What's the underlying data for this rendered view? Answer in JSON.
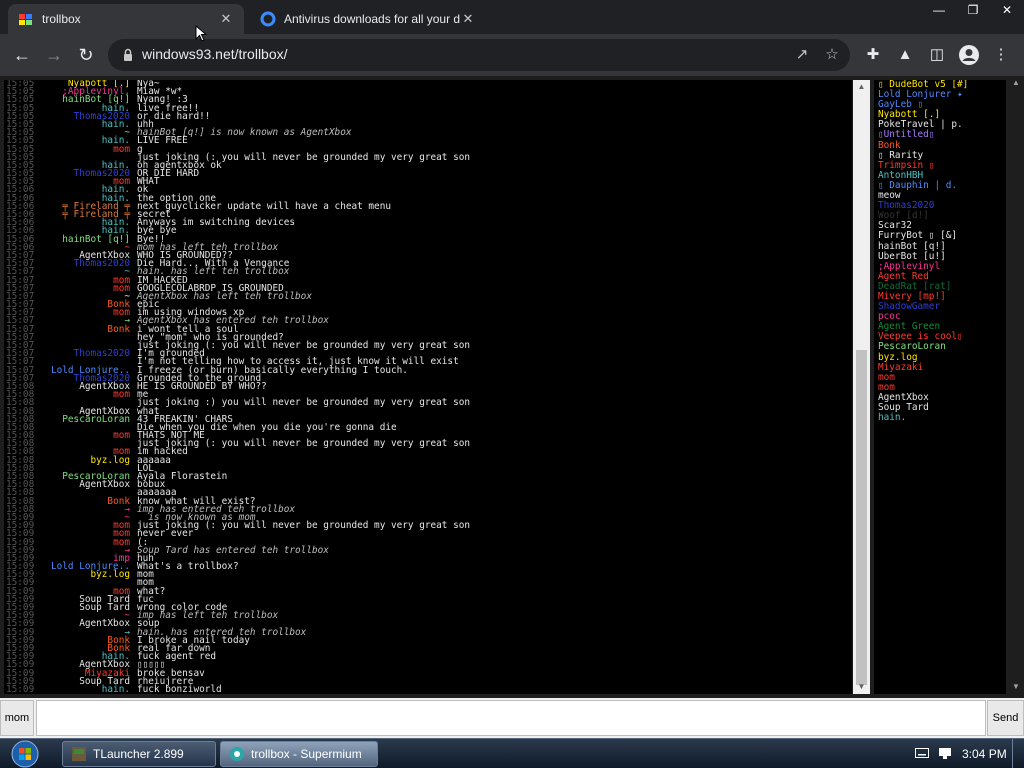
{
  "browser": {
    "tabs": [
      {
        "title": "trollbox",
        "close": "✕"
      },
      {
        "title": "Antivirus downloads for all your de",
        "close": "✕"
      }
    ],
    "window_buttons": [
      "—",
      "❐",
      "✕"
    ],
    "url": "windows93.net/trollbox/"
  },
  "chat": {
    "messages": [
      {
        "time": "15:05",
        "nick": "Nyabott [.]",
        "nick_color": "#ffe600",
        "text": "Nya~",
        "sys": false
      },
      {
        "time": "15:05",
        "nick": ";Applevinyl.",
        "nick_color": "#ff3399",
        "text": "Miaw *w*",
        "sys": false
      },
      {
        "time": "15:05",
        "nick": "hainBot [q!]",
        "nick_color": "#7ee07e",
        "text": "Nyang! :3",
        "sys": false
      },
      {
        "time": "15:05",
        "nick": "hain.",
        "nick_color": "#4fc3c3",
        "text": "live free!!",
        "sys": false
      },
      {
        "time": "15:05",
        "nick": "Thomas2020",
        "nick_color": "#2f3fd0",
        "text": "or die hard!!",
        "sys": false
      },
      {
        "time": "15:05",
        "nick": "hain.",
        "nick_color": "#4fc3c3",
        "text": "uhh",
        "sys": false
      },
      {
        "time": "15:05",
        "nick": "~",
        "nick_color": "#7ee07e",
        "text": "hainBot [q!] is now known as AgentXbox",
        "sys": true
      },
      {
        "time": "15:05",
        "nick": "hain.",
        "nick_color": "#4fc3c3",
        "text": "LIVE FREE",
        "sys": false
      },
      {
        "time": "15:05",
        "nick": "mom",
        "nick_color": "#ff3b30",
        "text": "g",
        "sys": false
      },
      {
        "time": "15:05",
        "nick": "",
        "nick_color": "#ff3b30",
        "text": "just joking (: you will never be grounded my very great son",
        "sys": false
      },
      {
        "time": "15:05",
        "nick": "hain.",
        "nick_color": "#4fc3c3",
        "text": "oh agentxbox ok",
        "sys": false
      },
      {
        "time": "15:05",
        "nick": "Thomas2020",
        "nick_color": "#2f3fd0",
        "text": "OR DIE HARD",
        "sys": false
      },
      {
        "time": "15:05",
        "nick": "mom",
        "nick_color": "#ff3b30",
        "text": "WHAT",
        "sys": false
      },
      {
        "time": "15:06",
        "nick": "hain.",
        "nick_color": "#4fc3c3",
        "text": "ok",
        "sys": false
      },
      {
        "time": "15:06",
        "nick": "hain.",
        "nick_color": "#4fc3c3",
        "text": "the option one",
        "sys": false
      },
      {
        "time": "15:06",
        "nick": "╤ Fireland ╤",
        "nick_color": "#e07a3a",
        "text": "next guyclicker update will have a cheat menu",
        "sys": false
      },
      {
        "time": "15:06",
        "nick": "╤ Fireland ╤",
        "nick_color": "#e07a3a",
        "text": "secret",
        "sys": false
      },
      {
        "time": "15:06",
        "nick": "hain.",
        "nick_color": "#4fc3c3",
        "text": "Anyways im switching devices",
        "sys": false
      },
      {
        "time": "15:06",
        "nick": "hain.",
        "nick_color": "#4fc3c3",
        "text": "bye bye",
        "sys": false
      },
      {
        "time": "15:06",
        "nick": "hainBot [q!]",
        "nick_color": "#7ee07e",
        "text": "Bye!!",
        "sys": false
      },
      {
        "time": "15:06",
        "nick": "~",
        "nick_color": "#ff3b30",
        "text": "mom has left teh trollbox",
        "sys": true
      },
      {
        "time": "15:07",
        "nick": "AgentXbox",
        "nick_color": "#e6e6e6",
        "text": "WHO IS GROUNDED??",
        "sys": false
      },
      {
        "time": "15:07",
        "nick": "Thomas2020",
        "nick_color": "#2f3fd0",
        "text": "Die Hard... With a Vengance",
        "sys": false
      },
      {
        "time": "15:07",
        "nick": "~",
        "nick_color": "#4fc3c3",
        "text": "hain. has left teh trollbox",
        "sys": true
      },
      {
        "time": "15:07",
        "nick": "mom",
        "nick_color": "#ff3b30",
        "text": "IM HACKED",
        "sys": false
      },
      {
        "time": "15:07",
        "nick": "mom",
        "nick_color": "#ff3b30",
        "text": "GOOGLECOLABRDP IS GROUNDED",
        "sys": false
      },
      {
        "time": "15:07",
        "nick": "~",
        "nick_color": "#e6e6e6",
        "text": "AgentXbox has left teh trollbox",
        "sys": true
      },
      {
        "time": "15:07",
        "nick": "Bonk",
        "nick_color": "#ff5a1f",
        "text": "epic",
        "sys": false
      },
      {
        "time": "15:07",
        "nick": "mom",
        "nick_color": "#ff3b30",
        "text": "im using windows xp",
        "sys": false
      },
      {
        "time": "15:07",
        "nick": "→",
        "nick_color": "#7ee07e",
        "text": "AgentXbox has entered teh trollbox",
        "sys": true
      },
      {
        "time": "15:07",
        "nick": "Bonk",
        "nick_color": "#ff5a1f",
        "text": "i wont tell a soul",
        "sys": false
      },
      {
        "time": "15:07",
        "nick": "",
        "nick_color": "#ff5a1f",
        "text": "hey \"mom\" who is grounded?",
        "sys": false
      },
      {
        "time": "15:07",
        "nick": "",
        "nick_color": "#ff3b30",
        "text": "just joking (: you will never be grounded my very great son",
        "sys": false
      },
      {
        "time": "15:07",
        "nick": "Thomas2020",
        "nick_color": "#2f3fd0",
        "text": "I'm grounded",
        "sys": false
      },
      {
        "time": "15:07",
        "nick": "",
        "nick_color": "#2f3fd0",
        "text": "I'm not telling how to access it, just know it will exist",
        "sys": false
      },
      {
        "time": "15:07",
        "nick": "Lold Lonjure..",
        "nick_color": "#4f8cff",
        "text": "I freeze (or burn) basically everything I touch.",
        "sys": false
      },
      {
        "time": "15:07",
        "nick": "Thomas2020",
        "nick_color": "#2f3fd0",
        "text": "Grounded to the ground",
        "sys": false
      },
      {
        "time": "15:08",
        "nick": "AgentXbox",
        "nick_color": "#e6e6e6",
        "text": "HE IS GROUNDED BY WHO??",
        "sys": false
      },
      {
        "time": "15:08",
        "nick": "mom",
        "nick_color": "#ff3b30",
        "text": "me",
        "sys": false
      },
      {
        "time": "15:08",
        "nick": "",
        "nick_color": "#ff3b30",
        "text": "just joking :) you will never be grounded my very great son",
        "sys": false
      },
      {
        "time": "15:08",
        "nick": "AgentXbox",
        "nick_color": "#e6e6e6",
        "text": "what",
        "sys": false
      },
      {
        "time": "15:08",
        "nick": "PescaroLoran",
        "nick_color": "#7ee07e",
        "text": "43 FREAKIN' CHARS",
        "sys": false
      },
      {
        "time": "15:08",
        "nick": "",
        "nick_color": "#7ee07e",
        "text": "Die when you die when you die you're gonna die",
        "sys": false
      },
      {
        "time": "15:08",
        "nick": "mom",
        "nick_color": "#ff3b30",
        "text": "THATS NOT ME",
        "sys": false
      },
      {
        "time": "15:08",
        "nick": "",
        "nick_color": "#ff3b30",
        "text": "just joking (: you will never be grounded my very great son",
        "sys": false
      },
      {
        "time": "15:08",
        "nick": "mom",
        "nick_color": "#ff3b30",
        "text": "im hacked",
        "sys": false
      },
      {
        "time": "15:08",
        "nick": "byz.log",
        "nick_color": "#ffe600",
        "text": "aaaaaa",
        "sys": false
      },
      {
        "time": "15:08",
        "nick": "",
        "nick_color": "#ffe600",
        "text": "LOL",
        "sys": false
      },
      {
        "time": "15:08",
        "nick": "PescaroLoran",
        "nick_color": "#7ee07e",
        "text": "Ayala Florastein",
        "sys": false
      },
      {
        "time": "15:08",
        "nick": "AgentXbox",
        "nick_color": "#e6e6e6",
        "text": "bobux",
        "sys": false
      },
      {
        "time": "15:08",
        "nick": "",
        "nick_color": "#e6e6e6",
        "text": "aaaaaaa",
        "sys": false
      },
      {
        "time": "15:08",
        "nick": "Bonk",
        "nick_color": "#ff5a1f",
        "text": "know what will exist?",
        "sys": false
      },
      {
        "time": "15:08",
        "nick": "→",
        "nick_color": "#ff3399",
        "text": "imp has entered teh trollbox",
        "sys": true
      },
      {
        "time": "15:09",
        "nick": "~",
        "nick_color": "#ff3399",
        "text": "  is now known as mom",
        "sys": true
      },
      {
        "time": "15:09",
        "nick": "mom",
        "nick_color": "#ff3b30",
        "text": "just joking (: you will never be grounded my very great son",
        "sys": false
      },
      {
        "time": "15:09",
        "nick": "mom",
        "nick_color": "#ff3b30",
        "text": "never ever",
        "sys": false
      },
      {
        "time": "15:09",
        "nick": "mom",
        "nick_color": "#ff3b30",
        "text": "(:",
        "sys": false
      },
      {
        "time": "15:09",
        "nick": "→",
        "nick_color": "#ff3399",
        "text": "Soup Tard has entered teh trollbox",
        "sys": true
      },
      {
        "time": "15:09",
        "nick": "imp",
        "nick_color": "#ff3399",
        "text": "huh",
        "sys": false
      },
      {
        "time": "15:09",
        "nick": "Lold Lonjure..",
        "nick_color": "#4f8cff",
        "text": "What's a trollbox?",
        "sys": false
      },
      {
        "time": "15:09",
        "nick": "byz.log",
        "nick_color": "#ffe600",
        "text": "mom",
        "sys": false
      },
      {
        "time": "15:09",
        "nick": "",
        "nick_color": "#ffe600",
        "text": "mom",
        "sys": false
      },
      {
        "time": "15:09",
        "nick": "mom",
        "nick_color": "#ff3b30",
        "text": "what?",
        "sys": false
      },
      {
        "time": "15:09",
        "nick": "Soup Tard",
        "nick_color": "#e6e6e6",
        "text": "fuc",
        "sys": false
      },
      {
        "time": "15:09",
        "nick": "Soup Tard",
        "nick_color": "#e6e6e6",
        "text": "wrong color code",
        "sys": false
      },
      {
        "time": "15:09",
        "nick": "~",
        "nick_color": "#ff3399",
        "text": "imp has left teh trollbox",
        "sys": true
      },
      {
        "time": "15:09",
        "nick": "AgentXbox",
        "nick_color": "#e6e6e6",
        "text": "soup",
        "sys": false
      },
      {
        "time": "15:09",
        "nick": "→",
        "nick_color": "#4fc3c3",
        "text": "hain. has entered teh trollbox",
        "sys": true
      },
      {
        "time": "15:09",
        "nick": "Bonk",
        "nick_color": "#ff5a1f",
        "text": "I broke a nail today",
        "sys": false
      },
      {
        "time": "15:09",
        "nick": "Bonk",
        "nick_color": "#ff5a1f",
        "text": "real far down",
        "sys": false
      },
      {
        "time": "15:09",
        "nick": "hain.",
        "nick_color": "#4fc3c3",
        "text": "fuck agent red",
        "sys": false
      },
      {
        "time": "15:09",
        "nick": "AgentXbox",
        "nick_color": "#e6e6e6",
        "text": "▯▯▯▯▯",
        "sys": false
      },
      {
        "time": "15:09",
        "nick": "Miyazaki",
        "nick_color": "#ff3b30",
        "text": "broke bensav",
        "sys": false
      },
      {
        "time": "15:09",
        "nick": "Soup Tard",
        "nick_color": "#e6e6e6",
        "text": "rheiujrere",
        "sys": false
      },
      {
        "time": "15:09",
        "nick": "hain.",
        "nick_color": "#4fc3c3",
        "text": "fuck bonziworld",
        "sys": false
      }
    ]
  },
  "users": [
    {
      "name": "▯ DudeBot v5 [#]",
      "color": "#ffe600"
    },
    {
      "name": "Lold Lonjurer ✦",
      "color": "#4f8cff"
    },
    {
      "name": "GayLeb ▯",
      "color": "#4f8cff"
    },
    {
      "name": "Nyabott [.]",
      "color": "#ffe600"
    },
    {
      "name": "PokeTravel | p.",
      "color": "#e6e6e6"
    },
    {
      "name": "▯Untitled▯",
      "color": "#a67bff"
    },
    {
      "name": "Bonk",
      "color": "#ff5a1f"
    },
    {
      "name": "▯ Rarity",
      "color": "#e6e6e6"
    },
    {
      "name": "Trimpsin ▯",
      "color": "#ff3b30"
    },
    {
      "name": "AntonHBH",
      "color": "#4fc3c3"
    },
    {
      "name": "▯ Dauphin | d.",
      "color": "#4f8cff"
    },
    {
      "name": "meow",
      "color": "#e6e6e6"
    },
    {
      "name": "Thomas2020",
      "color": "#2f3fd0"
    },
    {
      "name": "Woof [d!]",
      "color": "#333333"
    },
    {
      "name": "Scar32",
      "color": "#e6e6e6"
    },
    {
      "name": "FurryBot ▯ [&]",
      "color": "#e6e6e6"
    },
    {
      "name": "hainBot [q!]",
      "color": "#e6e6e6"
    },
    {
      "name": "UberBot [u!]",
      "color": "#e6e6e6"
    },
    {
      "name": ";Applevinyl",
      "color": "#ff3399"
    },
    {
      "name": "Agent Red",
      "color": "#ff3b30"
    },
    {
      "name": "DeadRat [rat]",
      "color": "#0f6b3a"
    },
    {
      "name": "Mivery [mp!]",
      "color": "#ff3b30"
    },
    {
      "name": "ShadowGamer",
      "color": "#2f3fd0"
    },
    {
      "name": "pcoc",
      "color": "#ff3399"
    },
    {
      "name": "Agent Green",
      "color": "#0f8b3a"
    },
    {
      "name": "Veepee is cool▯",
      "color": "#ff3b30"
    },
    {
      "name": "PescaroLoran",
      "color": "#7ee07e"
    },
    {
      "name": "byz.log",
      "color": "#ffe600"
    },
    {
      "name": "Miyazaki",
      "color": "#ff3b30"
    },
    {
      "name": "mom",
      "color": "#ff3b30"
    },
    {
      "name": "mom",
      "color": "#ff3b30"
    },
    {
      "name": "AgentXbox",
      "color": "#e6e6e6"
    },
    {
      "name": "Soup Tard",
      "color": "#e6e6e6"
    },
    {
      "name": "hain.",
      "color": "#4fc3c3"
    }
  ],
  "input": {
    "nick_label": "mom",
    "value": "",
    "send_label": "Send"
  },
  "taskbar": {
    "items": [
      {
        "label": "TLauncher 2.899"
      },
      {
        "label": "trollbox - Supermium"
      }
    ],
    "clock": "3:04 PM"
  }
}
